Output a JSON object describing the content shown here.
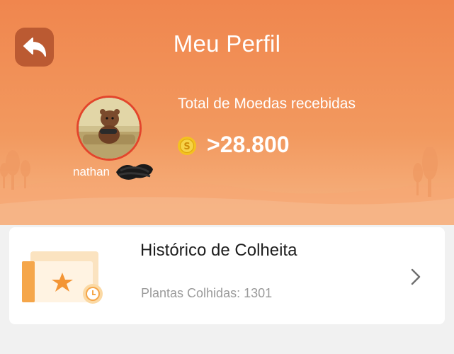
{
  "header": {
    "title": "Meu Perfil",
    "back_icon": "back-arrow-icon"
  },
  "profile": {
    "username": "nathan",
    "coins_label": "Total de Moedas recebidas",
    "coins_value": ">28.800",
    "coin_icon": "coin-icon"
  },
  "harvest_card": {
    "title": "Histórico de Colheita",
    "subtitle": "Plantas Colhidas: 1301",
    "chevron_icon": "chevron-right-icon"
  },
  "colors": {
    "header_orange": "#f0864e",
    "back_button": "#bb5a32",
    "avatar_border": "#e3452c",
    "coin_gold": "#f4c21f"
  }
}
